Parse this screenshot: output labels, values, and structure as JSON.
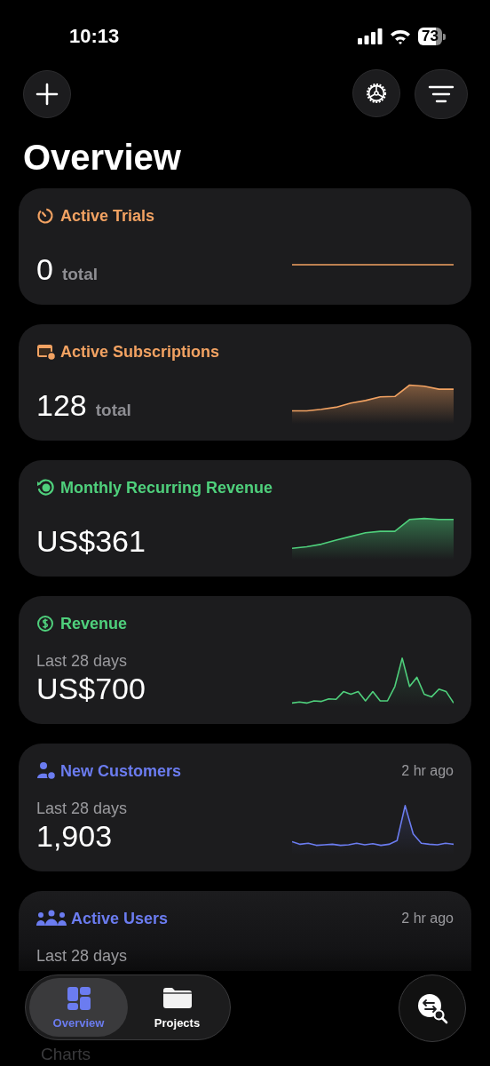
{
  "status_bar": {
    "time": "10:13",
    "battery": "73"
  },
  "header": {
    "title": "Overview"
  },
  "cards": [
    {
      "title": "Active Trials",
      "color": "#f2a262",
      "value": "0",
      "unit": "total"
    },
    {
      "title": "Active Subscriptions",
      "color": "#f2a262",
      "value": "128",
      "unit": "total"
    },
    {
      "title": "Monthly Recurring Revenue",
      "color": "#4fd07c",
      "value": "US$361"
    },
    {
      "title": "Revenue",
      "color": "#4fd07c",
      "subtitle": "Last 28 days",
      "value": "US$700"
    },
    {
      "title": "New Customers",
      "color": "#6b7cf0",
      "updated": "2 hr ago",
      "subtitle": "Last 28 days",
      "value": "1,903"
    },
    {
      "title": "Active Users",
      "color": "#6b7cf0",
      "updated": "2 hr ago",
      "subtitle": "Last 28 days"
    }
  ],
  "section_heading": "Charts",
  "tabs": [
    {
      "label": "Overview",
      "selected": true
    },
    {
      "label": "Projects",
      "selected": false
    }
  ]
}
